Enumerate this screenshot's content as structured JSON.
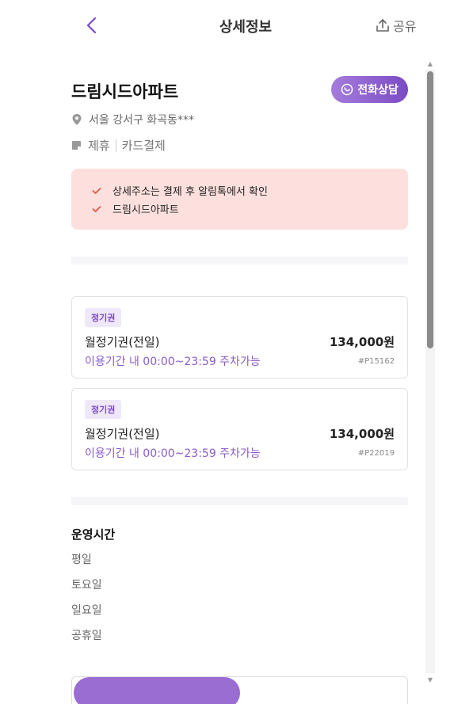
{
  "header": {
    "title": "상세정보",
    "share_label": "공유",
    "back_icon": "chevron-left-icon",
    "share_icon": "share-icon"
  },
  "place": {
    "name": "드림시드아파트",
    "call_label": "전화상담",
    "address": "서울 강서구 화곡동***",
    "tags": [
      "제휴",
      "카드결제"
    ]
  },
  "notice": {
    "items": [
      "상세주소는 결제 후 알림톡에서 확인",
      "드림시드아파트"
    ]
  },
  "tickets": [
    {
      "badge": "정기권",
      "name": "월정기권(전일)",
      "price": "134,000원",
      "desc": "이용기간 내 00:00~23:59 주차가능",
      "code": "#P15162"
    },
    {
      "badge": "정기권",
      "name": "월정기권(전일)",
      "price": "134,000원",
      "desc": "이용기간 내 00:00~23:59 주차가능",
      "code": "#P22019"
    }
  ],
  "hours": {
    "title": "운영시간",
    "days": [
      "평일",
      "토요일",
      "일요일",
      "공휴일"
    ]
  },
  "colors": {
    "accent": "#7b4bc4",
    "notice_bg": "#fde0dd",
    "check": "#e0523e"
  }
}
